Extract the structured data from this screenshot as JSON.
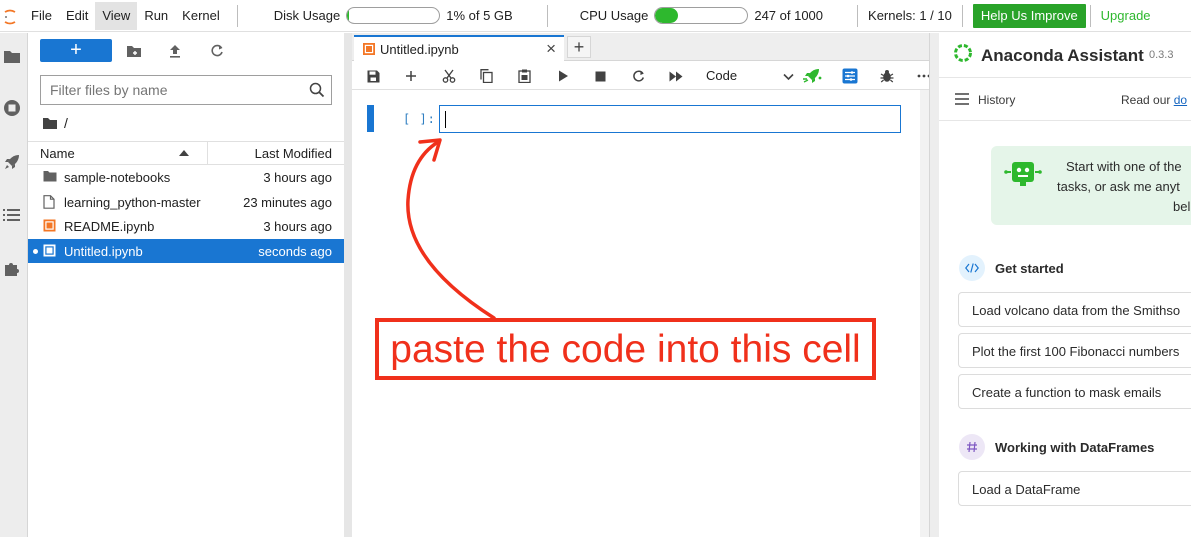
{
  "menubar": {
    "items": [
      "File",
      "Edit",
      "View",
      "Run",
      "Kernel"
    ],
    "active_item": "View",
    "disk_label": "Disk Usage",
    "disk_value": "1% of 5 GB",
    "disk_fraction": 0.01,
    "cpu_label": "CPU Usage",
    "cpu_value": "247 of 1000",
    "cpu_fraction": 0.247,
    "kernels": "Kernels: 1 / 10",
    "help_button": "Help Us Improve",
    "upgrade_link": "Upgrade",
    "bar_color": "#2eb82e"
  },
  "rail": {
    "icons": [
      "folder-icon",
      "running-icon",
      "rocket-icon",
      "toc-icon",
      "extension-icon"
    ]
  },
  "filebrowser": {
    "new_button": "+",
    "filter_placeholder": "Filter files by name",
    "breadcrumb": "/",
    "col_name": "Name",
    "col_modified": "Last Modified",
    "files": [
      {
        "name": "sample-notebooks",
        "modified": "3 hours ago",
        "icon": "folder-icon"
      },
      {
        "name": "learning_python-master",
        "modified": "23 minutes ago",
        "icon": "file-icon"
      },
      {
        "name": "README.ipynb",
        "modified": "3 hours ago",
        "icon": "notebook-icon"
      },
      {
        "name": "Untitled.ipynb",
        "modified": "seconds ago",
        "icon": "notebook-icon",
        "selected": true
      }
    ],
    "selected_color": "#1976d2"
  },
  "notebook": {
    "tab_label": "Untitled.ipynb",
    "tab_close": "×",
    "tab_add": "+",
    "cell_type": "Code",
    "cell_prompt": "[ ]:",
    "annotation": "paste the code into this cell",
    "annotation_color": "#f0301b"
  },
  "assistant": {
    "title": "Anaconda Assistant",
    "version": "0.3.3",
    "history": "History",
    "read_prefix": "Read our",
    "read_link": "do",
    "welcome_line1": "Start with one of the",
    "welcome_line2": "tasks, or ask me anyt",
    "welcome_line3": "bel",
    "get_started": "Get started",
    "suggestions": [
      "Load volcano data from the Smithso",
      "Plot the first 100 Fibonacci numbers",
      "Create a function to mask emails"
    ],
    "dataframes": "Working with DataFrames",
    "dataframe_items": [
      "Load a DataFrame"
    ],
    "accent_color": "#2eb82e"
  }
}
